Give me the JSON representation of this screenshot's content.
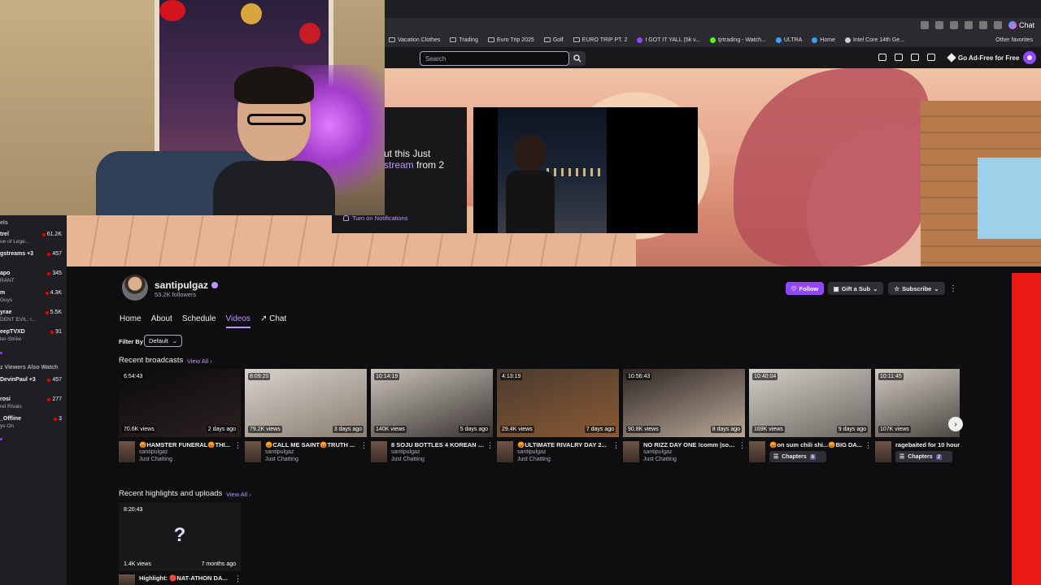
{
  "browser": {
    "chat_label": "Chat",
    "bookmarks": [
      {
        "label": "Vacation Clothes",
        "icon": "folder-icon"
      },
      {
        "label": "Trading",
        "icon": "folder-icon"
      },
      {
        "label": "Euro Trip 2025",
        "icon": "folder-icon"
      },
      {
        "label": "Golf",
        "icon": "folder-icon"
      },
      {
        "label": "EURO TRIP PT. 2",
        "icon": "folder-icon"
      },
      {
        "label": "I GOT IT YALL (5k v...",
        "icon": "twitch-icon",
        "color": "#9147ff"
      },
      {
        "label": "tjrtrading - Watch...",
        "icon": "kick-icon",
        "color": "#53fc18"
      },
      {
        "label": "ULTRA",
        "icon": "globe-icon",
        "color": "#3aa0ff"
      },
      {
        "label": "Home",
        "icon": "home-icon",
        "color": "#3aa0ff"
      },
      {
        "label": "Intel Core 14th Ge...",
        "icon": "page-icon",
        "color": "#cccccc"
      }
    ],
    "other_favorites": "Other favorites"
  },
  "topnav": {
    "search_placeholder": "Search",
    "adfree_label": "Go Ad-Free for Free"
  },
  "offline_card": {
    "line1": "ut this Just",
    "line2_highlight": "stream",
    "line2_rest": " from 2",
    "notifications_label": "Turn on Notifications"
  },
  "sidebar": {
    "title": "els",
    "items": [
      {
        "name": "trel",
        "game": "ue of Lege...",
        "viewers": "61.2K"
      },
      {
        "name": "gstreams +3",
        "game": "",
        "viewers": "457"
      },
      {
        "name": "apo",
        "game": "RANT",
        "viewers": "345"
      },
      {
        "name": "m",
        "game": "Guys",
        "viewers": "4.3K"
      },
      {
        "name": "yrae",
        "game": "DENT EVIL: r...",
        "viewers": "5.5K"
      },
      {
        "name": "eepTVXD",
        "game": "ter-Strike",
        "viewers": "91"
      }
    ],
    "also_watch_title": "z Viewers Also Watch",
    "also_watch": [
      {
        "name": "DevinPaul +3",
        "game": "",
        "viewers": "457"
      },
      {
        "name": "rosi",
        "game": "rel Rivals",
        "viewers": "277"
      },
      {
        "name": "_Offline",
        "game": "ys On",
        "viewers": "3"
      }
    ]
  },
  "channel": {
    "name": "santipulgaz",
    "followers": "53.2K followers",
    "follow_label": "Follow",
    "gift_label": "Gift a Sub",
    "subscribe_label": "Subscribe",
    "tabs": [
      "Home",
      "About",
      "Schedule",
      "Videos",
      "Chat"
    ],
    "active_tab": "Videos",
    "filter_label": "Filter By",
    "filter_value": "Default"
  },
  "recent_broadcasts": {
    "title": "Recent broadcasts",
    "view_all": "View All",
    "videos": [
      {
        "duration": "6:54:43",
        "views": "70.6K views",
        "ago": "2 days ago",
        "title": "😡HAMSTER FUNERAL😡THI...",
        "channel": "santipulgaz",
        "category": "Just Chatting",
        "colors": [
          "#0b0b0d",
          "#2b2020"
        ]
      },
      {
        "duration": "8:09:20",
        "views": "79.2K views",
        "ago": "3 days ago",
        "title": "😡CALL ME SAINT😡TRUTH ...",
        "channel": "santipulgaz",
        "category": "Just Chatting",
        "colors": [
          "#d6d2cc",
          "#8a7d70"
        ]
      },
      {
        "duration": "10:14:19",
        "views": "140K views",
        "ago": "5 days ago",
        "title": "8 SOJU BOTTLES 4 KOREAN F...",
        "channel": "santipulgaz",
        "category": "Just Chatting",
        "colors": [
          "#c9c3bb",
          "#3a3330"
        ]
      },
      {
        "duration": "4:13:19",
        "views": "29.4K views",
        "ago": "7 days ago",
        "title": "😡ULTIMATE RIVALRY DAY 2...",
        "channel": "santipulgaz",
        "category": "Just Chatting",
        "colors": [
          "#4a3a2e",
          "#8a5a34"
        ]
      },
      {
        "duration": "10:56:43",
        "views": "90.8K views",
        "ago": "8 days ago",
        "title": "NO RIZZ DAY ONE !comm |soci...",
        "channel": "santipulgaz",
        "category": "Just Chatting",
        "colors": [
          "#2e2624",
          "#b9a897"
        ]
      },
      {
        "duration": "10:40:04",
        "views": "169K views",
        "ago": "9 days ago",
        "title": "😡on sum chili shi...😡BIG DA...",
        "channel": "santipulgaz",
        "category": "",
        "chapters": "Chapters",
        "chapters_count": "6",
        "colors": [
          "#d1cdc7",
          "#6c6660"
        ]
      },
      {
        "duration": "10:11:45",
        "views": "107K views",
        "ago": "",
        "title": "ragebaited for 10 hour",
        "channel": "santipulgaz",
        "category": "",
        "chapters": "Chapters",
        "chapters_count": "2",
        "colors": [
          "#cfc9c1",
          "#4b4540"
        ]
      }
    ]
  },
  "recent_highlights": {
    "title": "Recent highlights and uploads",
    "view_all": "View All",
    "items": [
      {
        "duration": "8:20:43",
        "views": "1.4K views",
        "ago": "7 months ago",
        "title": "Highlight: 🔴NAT-ATHON DAY..."
      }
    ]
  }
}
